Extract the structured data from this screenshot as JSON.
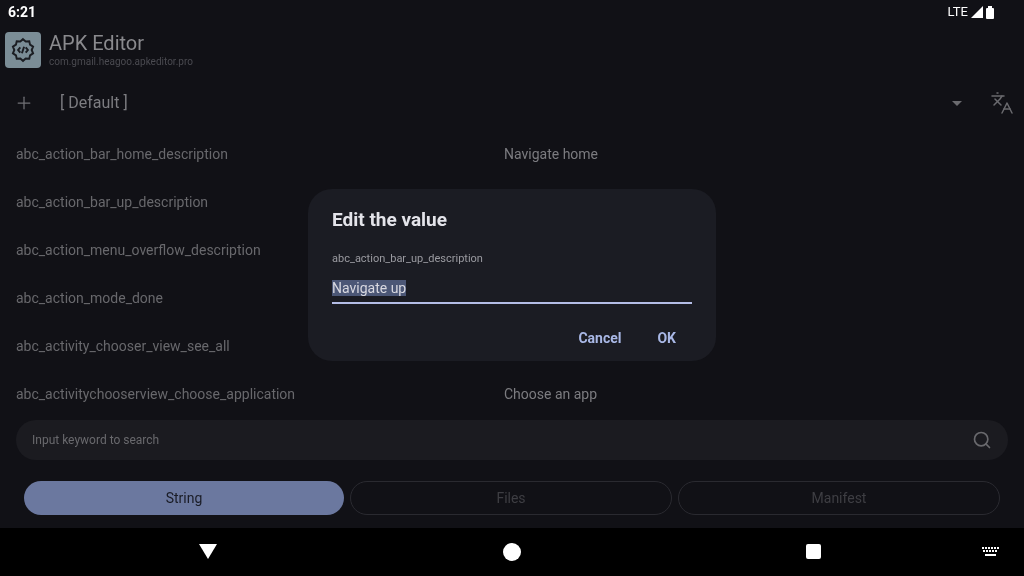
{
  "status_bar": {
    "time": "6:21",
    "network": "LTE"
  },
  "app": {
    "title": "APK Editor",
    "package": "com.gmail.heagoo.apkeditor.pro"
  },
  "toolbar": {
    "language": "[ Default ]"
  },
  "strings": [
    {
      "key": "abc_action_bar_home_description",
      "value": "Navigate home"
    },
    {
      "key": "abc_action_bar_up_description"
    },
    {
      "key": "abc_action_menu_overflow_description"
    },
    {
      "key": "abc_action_mode_done"
    },
    {
      "key": "abc_activity_chooser_view_see_all"
    },
    {
      "key": "abc_activitychooserview_choose_application",
      "value": "Choose an app"
    }
  ],
  "search": {
    "placeholder": "Input keyword to search"
  },
  "tabs": [
    {
      "label": "String",
      "selected": true
    },
    {
      "label": "Files",
      "selected": false
    },
    {
      "label": "Manifest",
      "selected": false
    }
  ],
  "dialog": {
    "title": "Edit the value",
    "label": "abc_action_bar_up_description",
    "value": "Navigate up",
    "value_selected": true,
    "buttons": [
      "Cancel",
      "OK"
    ]
  }
}
